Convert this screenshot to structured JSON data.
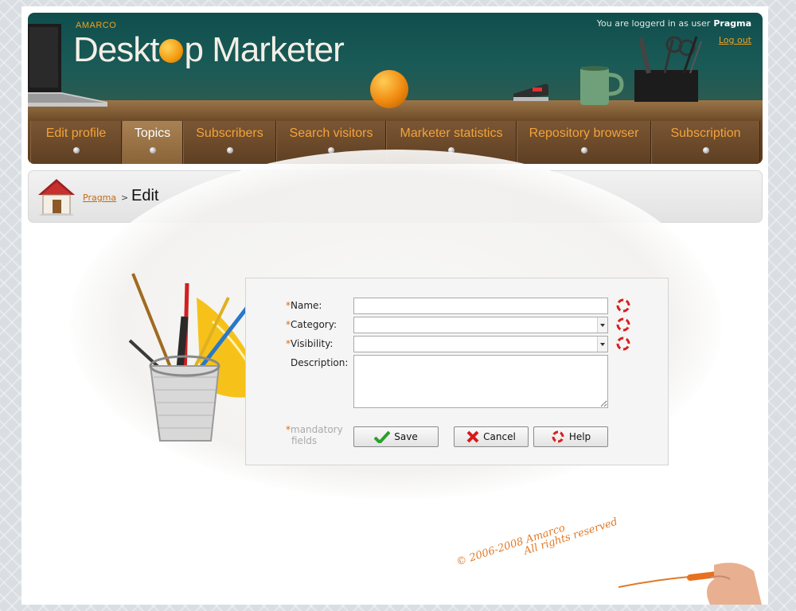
{
  "header": {
    "sub_brand": "AMARCO",
    "brand_part1": "Deskt",
    "brand_part2": "p ",
    "brand_part3": "Marketer",
    "user_prefix": "You are loggerd in as user",
    "user_name": "Pragma",
    "logout_label": "Log out"
  },
  "nav": {
    "items": [
      {
        "label": "Edit profile"
      },
      {
        "label": "Topics",
        "active": true
      },
      {
        "label": "Subscribers"
      },
      {
        "label": "Search visitors"
      },
      {
        "label": "Marketer statistics"
      },
      {
        "label": "Repository browser"
      },
      {
        "label": "Subscription"
      }
    ]
  },
  "breadcrumb": {
    "link": "Pragma",
    "separator": ">",
    "current": "Edit"
  },
  "form": {
    "required_mark": "*",
    "name_label": "Name:",
    "category_label": "Category:",
    "visibility_label": "Visibility:",
    "description_label": "Description:",
    "name_value": "",
    "category_value": "",
    "visibility_value": "",
    "description_value": "",
    "mandatory_line1": "mandatory",
    "mandatory_line2": "fields",
    "save_label": "Save",
    "cancel_label": "Cancel",
    "help_label": "Help"
  },
  "footer": {
    "copyright": "© 2006-2008 Amarco",
    "rights": "All rights reserved"
  },
  "colors": {
    "accent": "#f3a33a",
    "link": "#c86a10",
    "required": "#e06a12"
  }
}
